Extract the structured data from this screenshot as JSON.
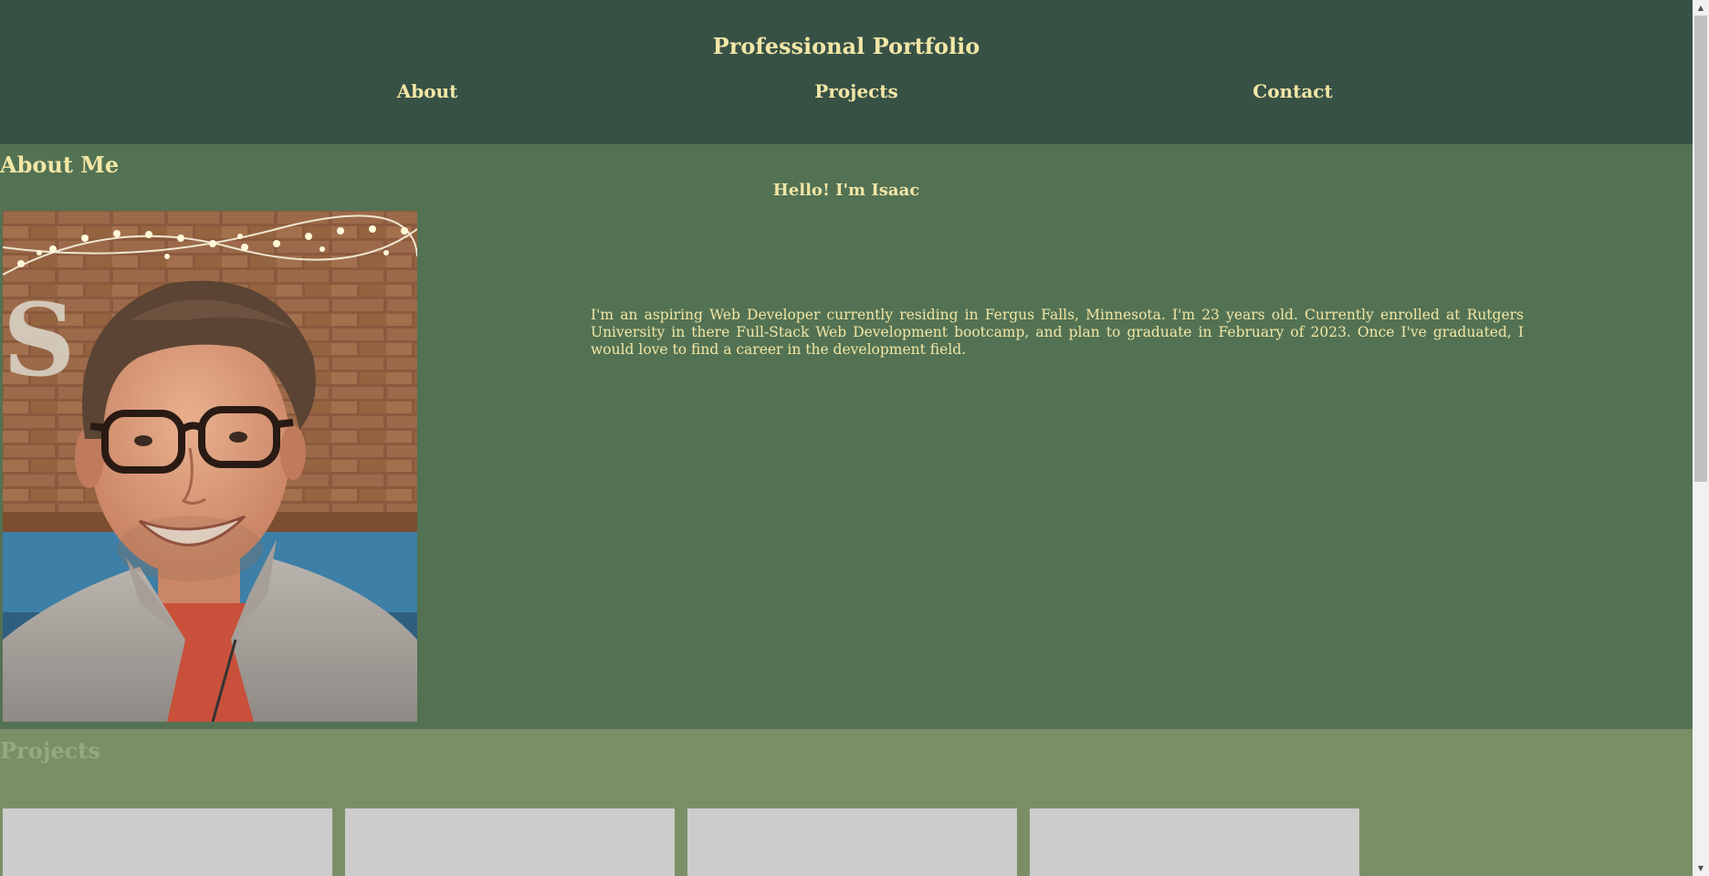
{
  "header": {
    "title": "Professional Portfolio",
    "nav": {
      "about": "About",
      "projects": "Projects",
      "contact": "Contact"
    }
  },
  "about": {
    "heading": "About Me",
    "greeting": "Hello! I'm Isaac",
    "bio": "I'm an aspiring Web Developer currently residing in Fergus Falls, Minnesota. I'm 23 years old. Currently enrolled at Rutgers University in there Full-Stack Web Development bootcamp, and plan to graduate in February of 2023. Once I've graduated, I would love to find a career in the development field.",
    "photo_icon": "portrait-photo"
  },
  "projects": {
    "heading": "Projects",
    "cards": 4
  },
  "colors": {
    "header_bg": "#375145",
    "about_bg": "#537253",
    "projects_bg": "#7b8f67",
    "accent_text": "#f2e6a6",
    "card_bg": "#cccccc"
  },
  "scrollbar": {
    "up_icon": "▲",
    "down_icon": "▼"
  }
}
